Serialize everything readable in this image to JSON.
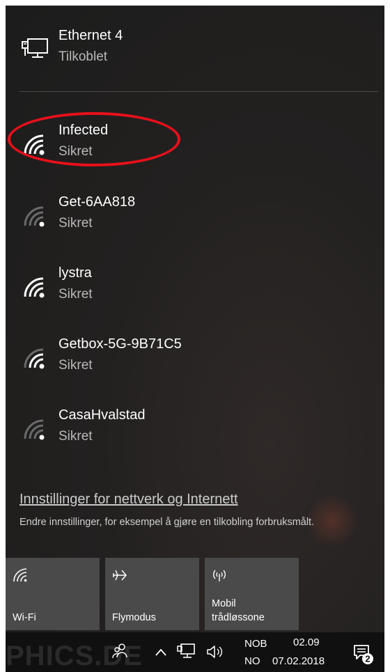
{
  "ethernet": {
    "name": "Ethernet 4",
    "status": "Tilkoblet",
    "icon": "ethernet-icon"
  },
  "networks": [
    {
      "name": "Infected",
      "status": "Sikret",
      "signal": "full",
      "highlighted": true
    },
    {
      "name": "Get-6AA818",
      "status": "Sikret",
      "signal": "low",
      "highlighted": false
    },
    {
      "name": "lystra",
      "status": "Sikret",
      "signal": "full",
      "highlighted": false
    },
    {
      "name": "Getbox-5G-9B71C5",
      "status": "Sikret",
      "signal": "medium",
      "highlighted": false
    },
    {
      "name": "CasaHvalstad",
      "status": "Sikret",
      "signal": "low",
      "highlighted": false
    }
  ],
  "settings": {
    "link": "Innstillinger for nettverk og Internett",
    "description": "Endre innstillinger, for eksempel å gjøre en tilkobling forbruksmålt."
  },
  "tiles": [
    {
      "label": "Wi-Fi",
      "icon": "wifi-icon"
    },
    {
      "label": "Flymodus",
      "icon": "airplane-icon"
    },
    {
      "label_line1": "Mobil",
      "label_line2": "trådløssone",
      "icon": "hotspot-icon"
    }
  ],
  "taskbar": {
    "watermark": "PHICS.DE",
    "lang_top": "NOB",
    "lang_bottom": "NO",
    "time": "02.09",
    "date": "07.02.2018",
    "notification_count": "2"
  },
  "colors": {
    "highlight": "#e8101a",
    "tile": "#4a4a4a",
    "flyout": "#232120"
  }
}
